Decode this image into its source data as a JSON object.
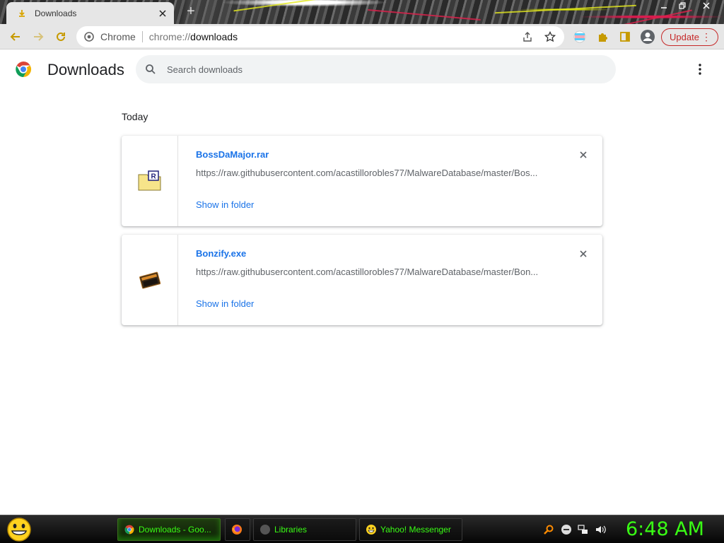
{
  "tab": {
    "title": "Downloads",
    "icon": "download-icon"
  },
  "toolbar": {
    "site_label": "Chrome",
    "url_scheme": "chrome://",
    "url_host": "downloads",
    "update_label": "Update"
  },
  "page": {
    "title": "Downloads",
    "search_placeholder": "Search downloads"
  },
  "downloads": {
    "date_header": "Today",
    "items": [
      {
        "name": "BossDaMajor.rar",
        "url": "https://raw.githubusercontent.com/acastillorobles77/MalwareDatabase/master/Bos...",
        "action": "Show in folder",
        "icon": "winrar-archive-icon"
      },
      {
        "name": "Bonzify.exe",
        "url": "https://raw.githubusercontent.com/acastillorobles77/MalwareDatabase/master/Bon...",
        "action": "Show in folder",
        "icon": "exe-application-icon"
      }
    ]
  },
  "taskbar": {
    "tasks": [
      {
        "label": "Downloads - Goo...",
        "icon": "chrome-icon",
        "active": true
      },
      {
        "label": "",
        "icon": "firefox-icon",
        "active": false
      },
      {
        "label": "Libraries",
        "icon": "libraries-icon",
        "active": false
      },
      {
        "label": "Yahoo! Messenger",
        "icon": "yahoo-messenger-icon",
        "active": false
      }
    ],
    "clock": "6:48 AM"
  },
  "colors": {
    "link_blue": "#1a73e8",
    "update_red": "#c62828",
    "taskbar_green": "#39ff14"
  }
}
